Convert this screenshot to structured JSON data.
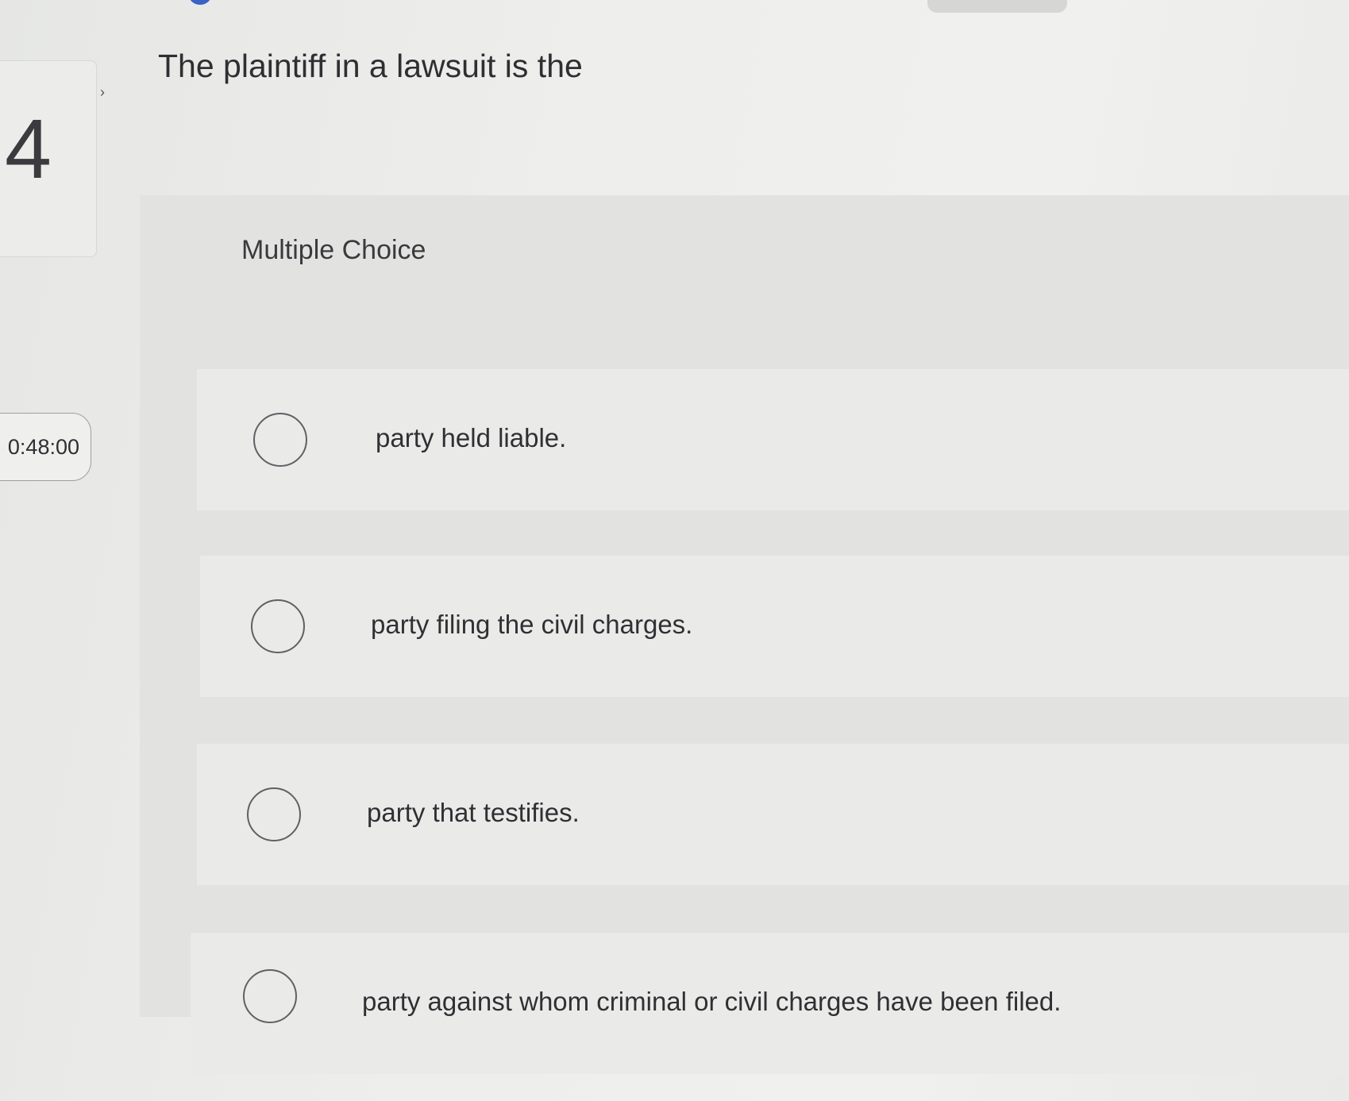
{
  "sidebar": {
    "question_number": "4",
    "timer": "0:48:00"
  },
  "question": {
    "text": "The plaintiff in a lawsuit is the",
    "type_label": "Multiple Choice"
  },
  "choices": [
    {
      "label": "party held liable."
    },
    {
      "label": "party filing the civil charges."
    },
    {
      "label": "party that testifies."
    },
    {
      "label": "party against whom criminal or civil charges have been filed."
    }
  ],
  "colors": {
    "background": "#ecedeb",
    "panel": "#e2e3e1",
    "row": "#eaebe9",
    "text": "#2f2f33",
    "radio_border": "#5f6064",
    "accent_dot": "#3a63c6"
  },
  "icons": {
    "radio": "radio-unselected-icon"
  }
}
